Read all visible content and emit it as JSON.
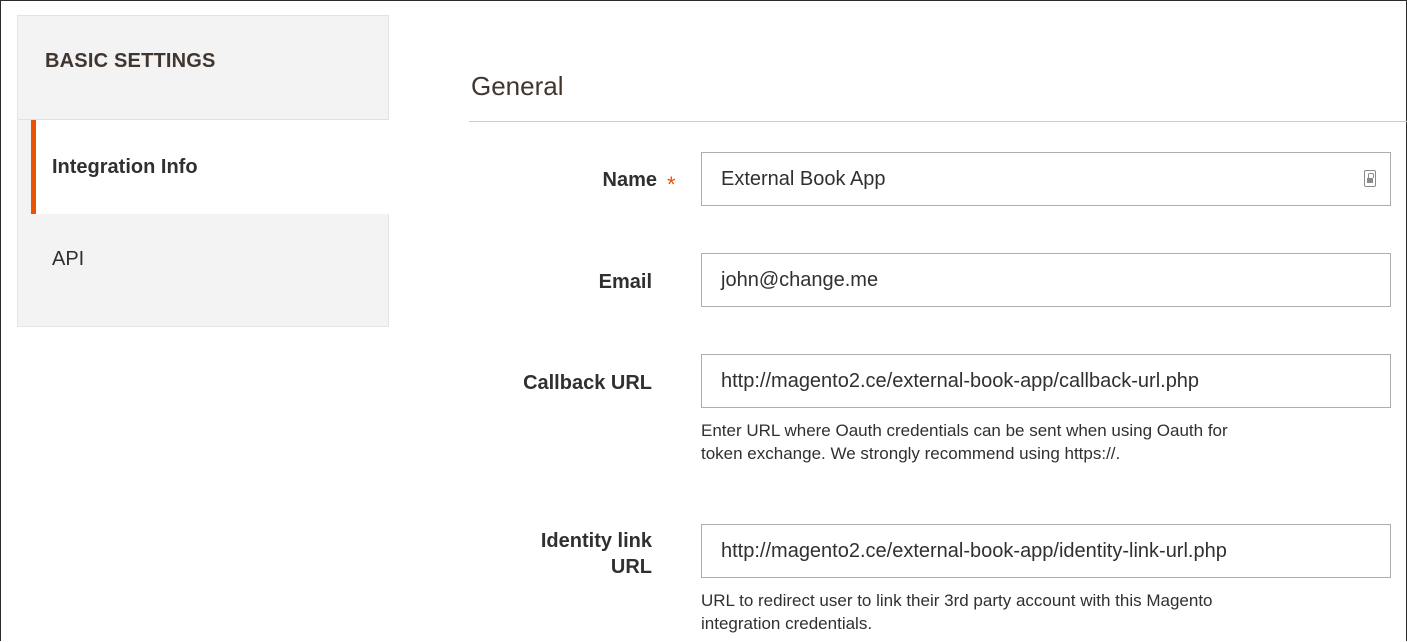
{
  "sidebar": {
    "title": "BASIC SETTINGS",
    "items": [
      {
        "label": "Integration Info",
        "active": true
      },
      {
        "label": "API",
        "active": false
      }
    ],
    "accent_color": "#eb5202"
  },
  "section": {
    "title": "General"
  },
  "form": {
    "name": {
      "label": "Name",
      "required_mark": "*",
      "value": "External Book App"
    },
    "email": {
      "label": "Email",
      "value": "john@change.me"
    },
    "callback_url": {
      "label": "Callback URL",
      "value": "http://magento2.ce/external-book-app/callback-url.php",
      "note_line1": "Enter URL where Oauth credentials can be sent when using Oauth for",
      "note_line2": "token exchange. We strongly recommend using https://."
    },
    "identity_link_url": {
      "label_line1": "Identity link",
      "label_line2": "URL",
      "value": "http://magento2.ce/external-book-app/identity-link-url.php",
      "note_line1": "URL to redirect user to link their 3rd party account with this Magento",
      "note_line2": "integration credentials."
    }
  }
}
